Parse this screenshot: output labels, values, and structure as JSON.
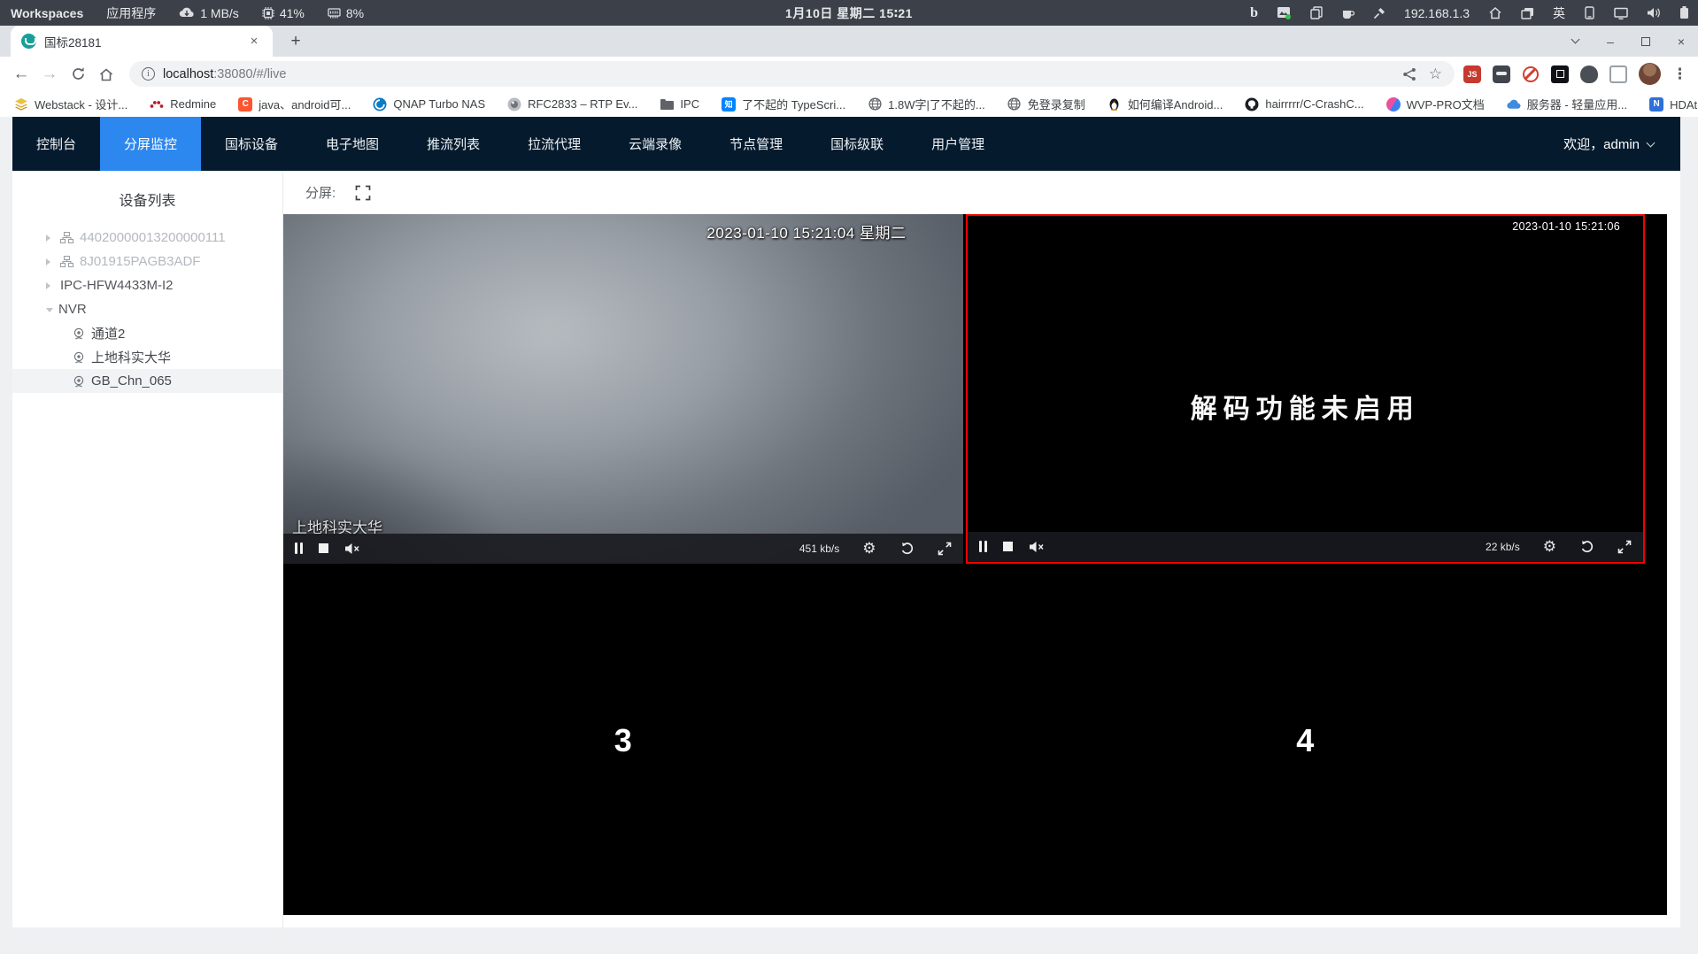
{
  "glyphs": {
    "back": "←",
    "forward": "→",
    "star": "☆",
    "menu": "⋮",
    "overflow": "»",
    "plus": "+",
    "close": "×",
    "minimize": "–",
    "gear": "⚙",
    "bing": "b",
    "info": "i"
  },
  "system_bar": {
    "workspaces": "Workspaces",
    "applications": "应用程序",
    "network_rate": "1 MB/s",
    "cpu_usage": "41%",
    "memory_usage": "8%",
    "clock": "1月10日 星期二 15∶21",
    "ip_address": "192.168.1.3",
    "input_method": "英"
  },
  "browser": {
    "tab_title": "国标28181",
    "url_host": "localhost",
    "url_rest": ":38080/#/live",
    "bookmarks": [
      {
        "label": "Webstack - 设计..."
      },
      {
        "label": "Redmine"
      },
      {
        "label": "java、android可...",
        "badge": "C"
      },
      {
        "label": "QNAP Turbo NAS"
      },
      {
        "label": "RFC2833 – RTP Ev..."
      },
      {
        "label": "IPC"
      },
      {
        "label": "了不起的 TypeScri...",
        "badge": "知"
      },
      {
        "label": "1.8W字|了不起的..."
      },
      {
        "label": "免登录复制"
      },
      {
        "label": "如何编译Android..."
      },
      {
        "label": "hairrrrr/C-CrashC..."
      },
      {
        "label": "WVP-PRO文档"
      },
      {
        "label": "服务器 - 轻量应用..."
      },
      {
        "label": "HDAtmos :: 种子 *...",
        "badge": "N"
      }
    ],
    "ext_js_badge": "JS"
  },
  "app": {
    "nav": {
      "tabs": [
        {
          "label": "控制台"
        },
        {
          "label": "分屏监控"
        },
        {
          "label": "国标设备"
        },
        {
          "label": "电子地图"
        },
        {
          "label": "推流列表"
        },
        {
          "label": "拉流代理"
        },
        {
          "label": "云端录像"
        },
        {
          "label": "节点管理"
        },
        {
          "label": "国标级联"
        },
        {
          "label": "用户管理"
        }
      ],
      "active_tab": "分屏监控",
      "welcome": "欢迎，admin"
    },
    "sidebar": {
      "title": "设备列表",
      "items": [
        {
          "label": "44020000013200000111"
        },
        {
          "label": "8J01915PAGB3ADF"
        },
        {
          "label": "IPC-HFW4433M-I2"
        },
        {
          "label": "NVR"
        },
        {
          "label": "通道2"
        },
        {
          "label": "上地科实大华"
        },
        {
          "label": "GB_Chn_065"
        }
      ]
    },
    "split_toolbar": {
      "label": "分屏:"
    },
    "videos": {
      "v1": {
        "timestamp": "2023-01-10 15:21:04 星期二",
        "name": "上地科实大华",
        "bitrate": "451 kb/s"
      },
      "v2": {
        "timestamp": "2023-01-10 15:21:06",
        "message": "解码功能未启用",
        "bitrate": "22 kb/s"
      },
      "v3": {
        "label": "3"
      },
      "v4": {
        "label": "4"
      }
    },
    "colors": {
      "accent_blue": "#2c87ee",
      "navbar_bg": "#051b2d",
      "selected_border": "#f40000"
    }
  }
}
